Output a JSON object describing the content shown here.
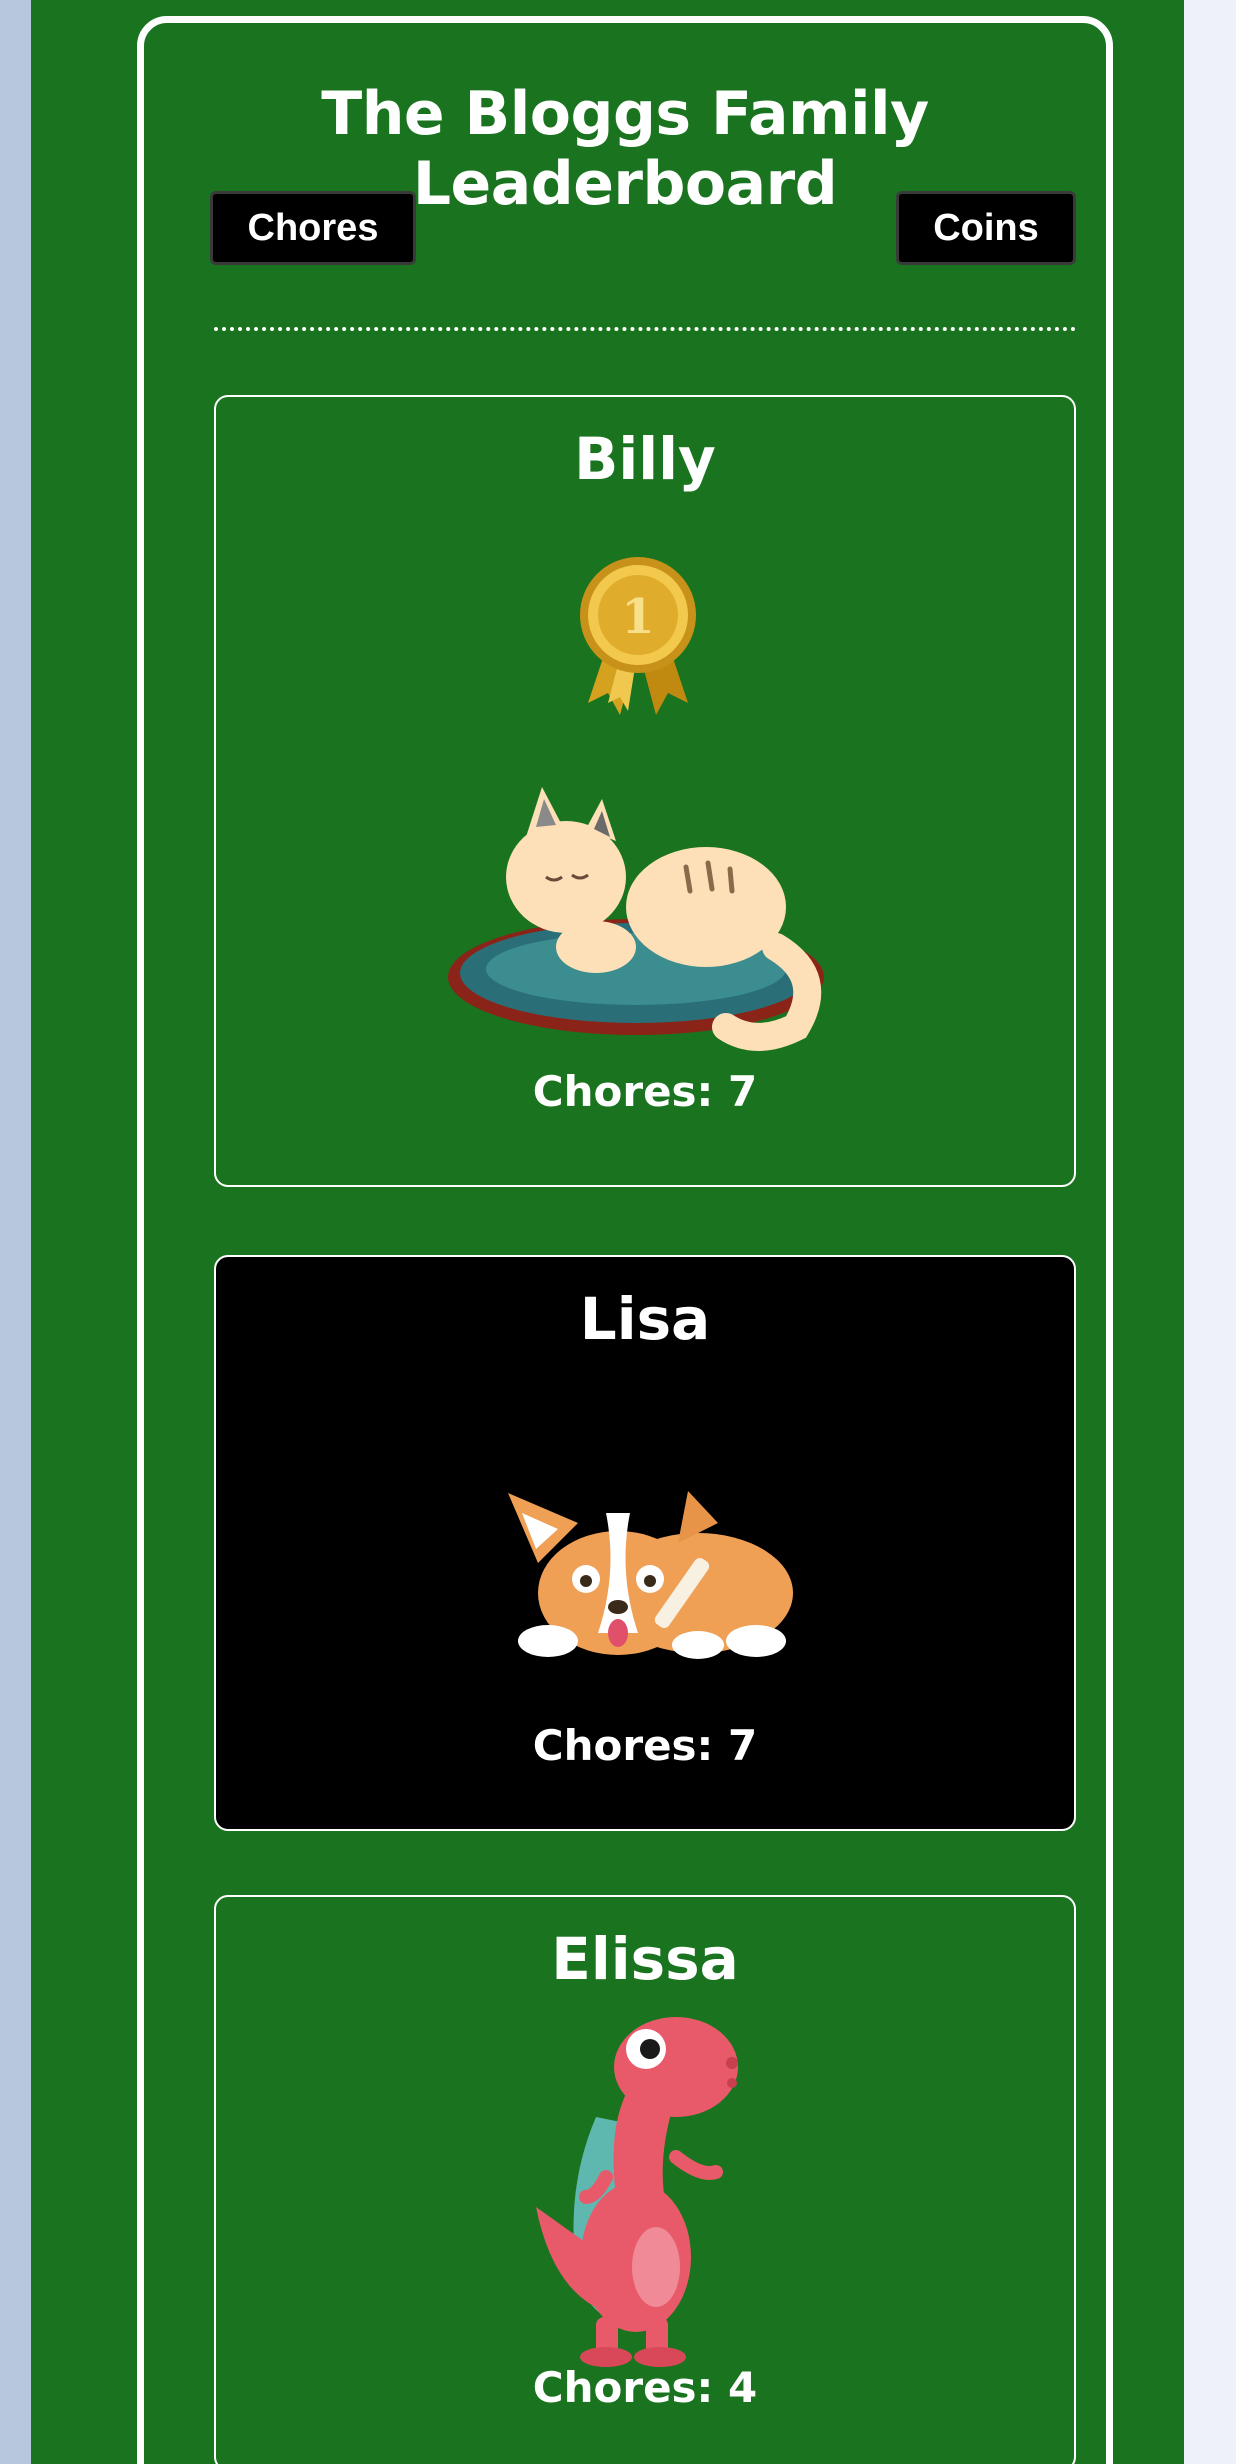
{
  "board": {
    "title": "The Bloggs Family Leaderboard"
  },
  "tabs": {
    "chores_label": "Chores",
    "coins_label": "Coins"
  },
  "members": [
    {
      "name": "Billy",
      "chores": "Chores: 7",
      "pet": "sleeping-cat-icon",
      "badge": "gold-medal-rank-1-icon",
      "medal_number": "1"
    },
    {
      "name": "Lisa",
      "chores": "Chores: 7",
      "pet": "corgi-with-bone-icon"
    },
    {
      "name": "Elissa",
      "chores": "Chores: 4",
      "pet": "pink-dinosaur-icon"
    }
  ],
  "colors": {
    "background": "#1a731e",
    "highlight_card": "#000000",
    "text": "#ffffff"
  }
}
